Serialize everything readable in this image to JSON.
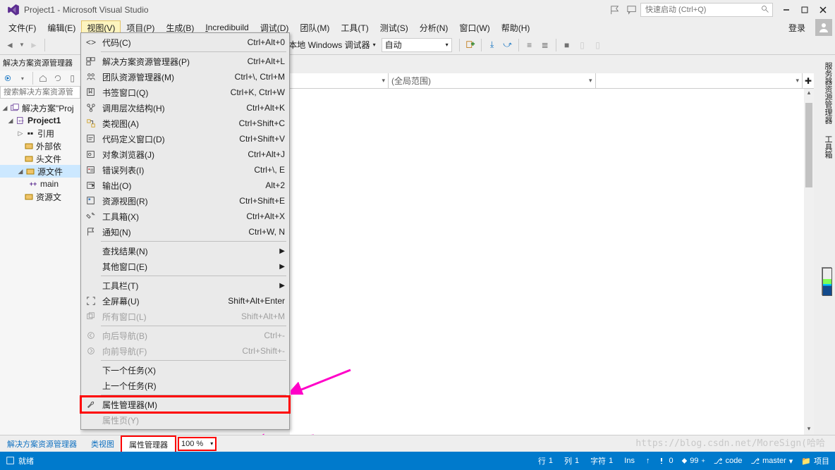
{
  "title": {
    "project": "Project1",
    "app": "Microsoft Visual Studio"
  },
  "quicklaunch": {
    "placeholder": "快速启动 (Ctrl+Q)"
  },
  "menubar": {
    "file": "文件(F)",
    "edit": "编辑(E)",
    "view": "视图(V)",
    "project": "项目(P)",
    "build": "生成(B)",
    "incredibuild": "Incredibuild",
    "debug": "调试(D)",
    "team": "团队(M)",
    "tools": "工具(T)",
    "test": "测试(S)",
    "analyze": "分析(N)",
    "window": "窗口(W)",
    "help": "帮助(H)",
    "login": "登录"
  },
  "toolbar": {
    "debug_target": "本地 Windows 调试器",
    "config": "自动"
  },
  "editor": {
    "scope": "(全局范围)"
  },
  "view_menu": {
    "code": {
      "label": "代码(C)",
      "short": "Ctrl+Alt+0"
    },
    "solution_explorer": {
      "label": "解决方案资源管理器(P)",
      "short": "Ctrl+Alt+L"
    },
    "team_explorer": {
      "label": "团队资源管理器(M)",
      "short": "Ctrl+\\, Ctrl+M"
    },
    "bookmarks": {
      "label": "书签窗口(Q)",
      "short": "Ctrl+K, Ctrl+W"
    },
    "call_hierarchy": {
      "label": "调用层次结构(H)",
      "short": "Ctrl+Alt+K"
    },
    "class_view": {
      "label": "类视图(A)",
      "short": "Ctrl+Shift+C"
    },
    "code_def": {
      "label": "代码定义窗口(D)",
      "short": "Ctrl+Shift+V"
    },
    "object_browser": {
      "label": "对象浏览器(J)",
      "short": "Ctrl+Alt+J"
    },
    "error_list": {
      "label": "错误列表(I)",
      "short": "Ctrl+\\, E"
    },
    "output": {
      "label": "输出(O)",
      "short": "Alt+2"
    },
    "resource_view": {
      "label": "资源视图(R)",
      "short": "Ctrl+Shift+E"
    },
    "toolbox": {
      "label": "工具箱(X)",
      "short": "Ctrl+Alt+X"
    },
    "notifications": {
      "label": "通知(N)",
      "short": "Ctrl+W, N"
    },
    "find_results": {
      "label": "查找结果(N)"
    },
    "other_windows": {
      "label": "其他窗口(E)"
    },
    "toolbars": {
      "label": "工具栏(T)"
    },
    "fullscreen": {
      "label": "全屏幕(U)",
      "short": "Shift+Alt+Enter"
    },
    "all_windows": {
      "label": "所有窗口(L)",
      "short": "Shift+Alt+M"
    },
    "nav_back": {
      "label": "向后导航(B)",
      "short": "Ctrl+-"
    },
    "nav_fwd": {
      "label": "向前导航(F)",
      "short": "Ctrl+Shift+-"
    },
    "next_task": {
      "label": "下一个任务(X)"
    },
    "prev_task": {
      "label": "上一个任务(R)"
    },
    "property_manager": {
      "label": "属性管理器(M)"
    },
    "property_page": {
      "label": "属性页(Y)"
    }
  },
  "solution_panel": {
    "title": "解决方案资源管理器",
    "search_placeholder": "搜索解决方案资源管",
    "solution": "解决方案\"Proj",
    "project": "Project1",
    "references": "引用",
    "external": "外部依",
    "headers": "头文件",
    "sources": "源文件",
    "main": "main",
    "resources": "资源文"
  },
  "bottom_tabs": {
    "solution": "解决方案资源管理器",
    "class_view": "类视图",
    "property_manager": "属性管理器",
    "zoom": "100 %"
  },
  "right_tabs": {
    "server_explorer": "服务器资源管理器",
    "toolbox": "工具箱"
  },
  "status": {
    "ready": "就绪",
    "line_label": "行",
    "line": "1",
    "col_label": "列",
    "col": "1",
    "char_label": "字符",
    "char": "1",
    "ins": "Ins",
    "errors": "0",
    "warnings": "99",
    "info": "code",
    "branch": "master",
    "repo": "项目"
  },
  "watermark": "https://blog.csdn.net/MoreSign(哈哈"
}
